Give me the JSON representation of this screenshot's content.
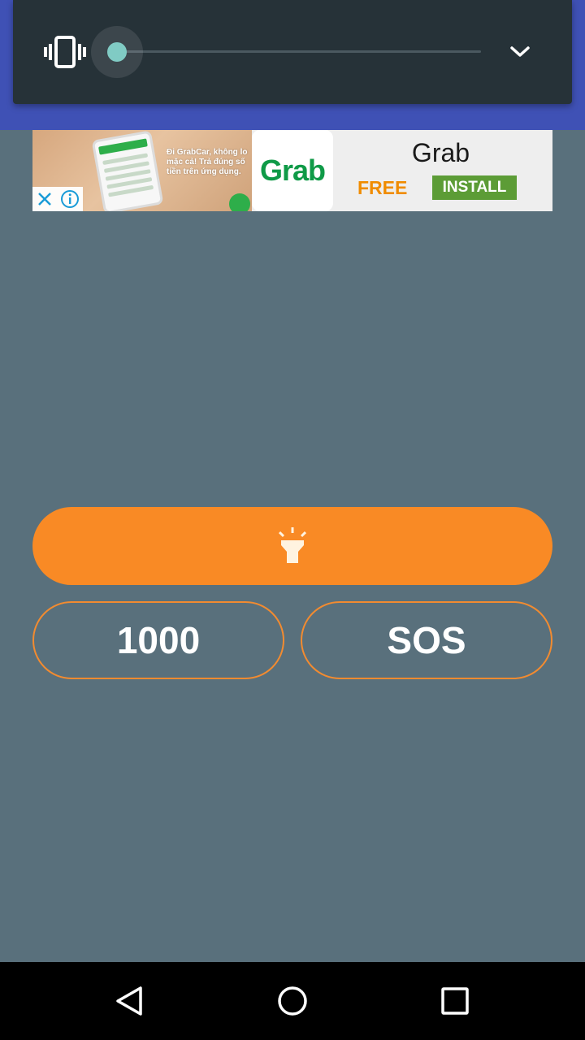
{
  "volume_panel": {
    "mode_icon": "vibrate-icon",
    "level": 0,
    "accent": "#80cbc4",
    "expand_icon": "chevron-down-icon"
  },
  "ad": {
    "copy_lines": [
      "Đi GrabCar, không lo",
      "mặc cả! Trả đúng số",
      "tiền trên ứng dụng."
    ],
    "logo_text": "Grab",
    "title": "Grab",
    "price": "FREE",
    "install_label": "INSTALL",
    "close_icon": "close-icon",
    "info_icon": "info-icon"
  },
  "controls": {
    "flashlight_icon": "flashlight-icon",
    "flash_color": "#f98a25",
    "left_label": "1000",
    "right_label": "SOS"
  },
  "navbar": {
    "back_icon": "back-icon",
    "home_icon": "home-icon",
    "recents_icon": "recents-icon"
  }
}
